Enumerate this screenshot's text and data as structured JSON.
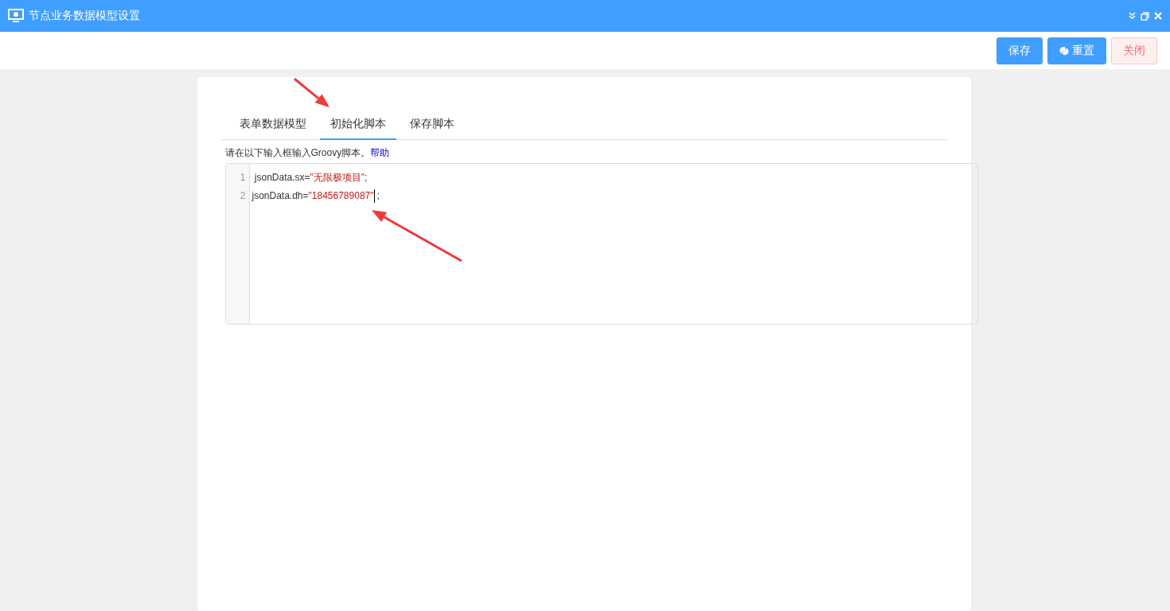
{
  "window": {
    "title": "节点业务数据模型设置"
  },
  "toolbar": {
    "buttons": [
      {
        "label": "保存",
        "kind": "primary"
      },
      {
        "label": "重置",
        "kind": "primary-icon"
      },
      {
        "label": "关闭",
        "kind": "danger"
      }
    ]
  },
  "tabs": [
    {
      "label": "表单数据模型",
      "selected": false
    },
    {
      "label": "初始化脚本",
      "selected": true
    },
    {
      "label": "保存脚本",
      "selected": false
    }
  ],
  "hint": {
    "text": "请在以下输入框输入Groovy脚本。",
    "link": "帮助"
  },
  "editor": {
    "lines": [
      {
        "number": "1",
        "segments": [
          {
            "kind": "plain",
            "text": " jsonData.sx="
          },
          {
            "kind": "string",
            "text": "\"无限极项目\""
          },
          {
            "kind": "plain",
            "text": ";"
          }
        ]
      },
      {
        "number": "2",
        "segments": [
          {
            "kind": "plain",
            "text": "jsonData.dh="
          },
          {
            "kind": "string",
            "text": "\"18456789087\""
          },
          {
            "kind": "cursor"
          },
          {
            "kind": "plain",
            "text": " ;"
          }
        ]
      }
    ]
  }
}
